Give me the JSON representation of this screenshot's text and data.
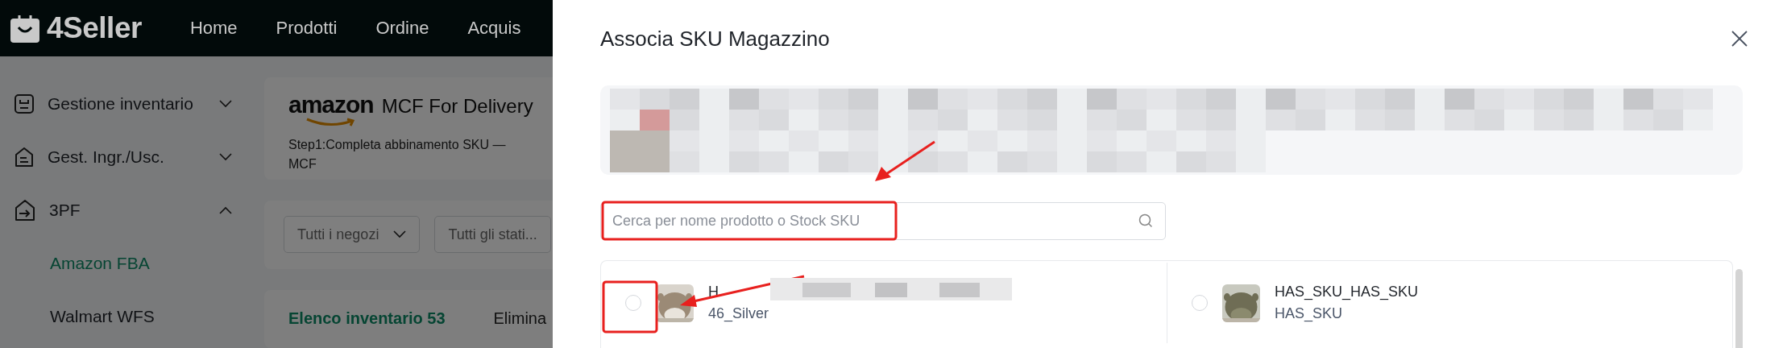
{
  "topbar": {
    "logo": "4Seller",
    "nav": [
      "Home",
      "Prodotti",
      "Ordine",
      "Acquis"
    ]
  },
  "sidebar": {
    "items": [
      {
        "label": "Gestione inventario",
        "expanded": false
      },
      {
        "label": "Gest. Ingr./Usc.",
        "expanded": false
      },
      {
        "label": "3PF",
        "expanded": true,
        "children": [
          {
            "label": "Amazon FBA",
            "selected": true
          },
          {
            "label": "Walmart WFS",
            "selected": false
          }
        ]
      }
    ]
  },
  "header": {
    "brand": "amazon",
    "title": "MCF For Delivery",
    "step": "Step1:Completa abbinamento SKU —",
    "step_continued": "MCF"
  },
  "filters": [
    {
      "label": "Tutti i negozi",
      "kind": "dropdown"
    },
    {
      "label": "Tutti gli stati...",
      "kind": "plain"
    }
  ],
  "inventory": {
    "title": "Elenco inventario 53",
    "action": "Elimina"
  },
  "dialog": {
    "title": "Associa SKU Magazzino",
    "search": {
      "placeholder": "Cerca per nome prodotto o Stock SKU"
    },
    "products": [
      {
        "name": "H",
        "sku": "46_Silver",
        "selected": false
      },
      {
        "name": "HAS_SKU_HAS_SKU",
        "sku": "HAS_SKU",
        "selected": false
      }
    ]
  }
}
